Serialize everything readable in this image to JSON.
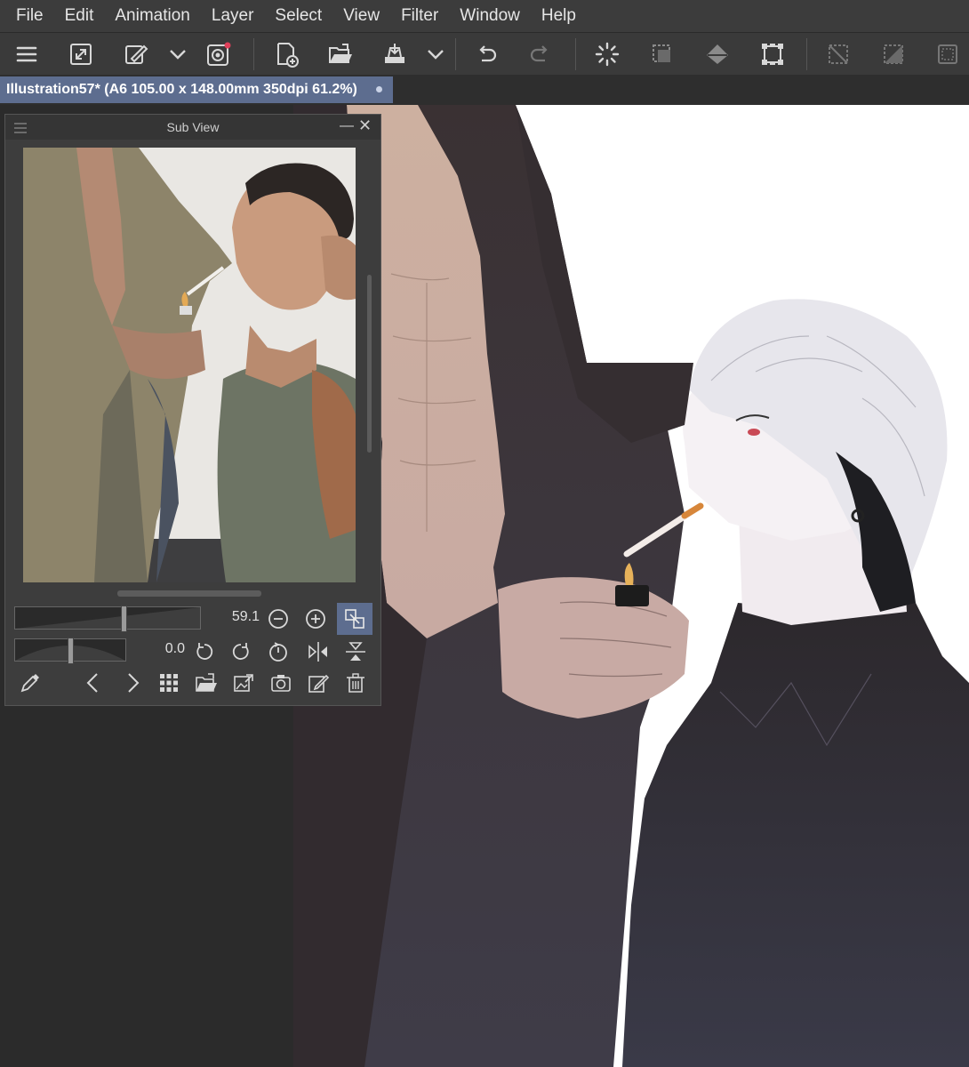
{
  "menu": [
    "File",
    "Edit",
    "Animation",
    "Layer",
    "Select",
    "View",
    "Filter",
    "Window",
    "Help"
  ],
  "toolbar": {
    "icons": [
      "hamburger-menu-icon",
      "fit-screen-icon",
      "brush-settings-icon",
      "chevron-down-icon",
      "companion-icon",
      "new-file-icon",
      "open-folder-icon",
      "save-icon",
      "chevron-down-icon",
      "undo-icon",
      "redo-icon",
      "loading-icon",
      "select-all-icon",
      "fill-icon",
      "transform-icon",
      "deselect-icon",
      "invert-selection-icon",
      "selection-border-icon"
    ]
  },
  "document": {
    "tab_title": "Illustration57* (A6 105.00 x 148.00mm 350dpi 61.2%)"
  },
  "subview": {
    "title": "Sub View",
    "zoom_value": "59.1",
    "rotation_value": "0.0",
    "zoom_level": 0.59,
    "rotation_level": 0.5
  },
  "colors": {
    "accent": "#5d6d8f",
    "menubar": "#3c3c3c",
    "panel": "#3d3d3d"
  }
}
